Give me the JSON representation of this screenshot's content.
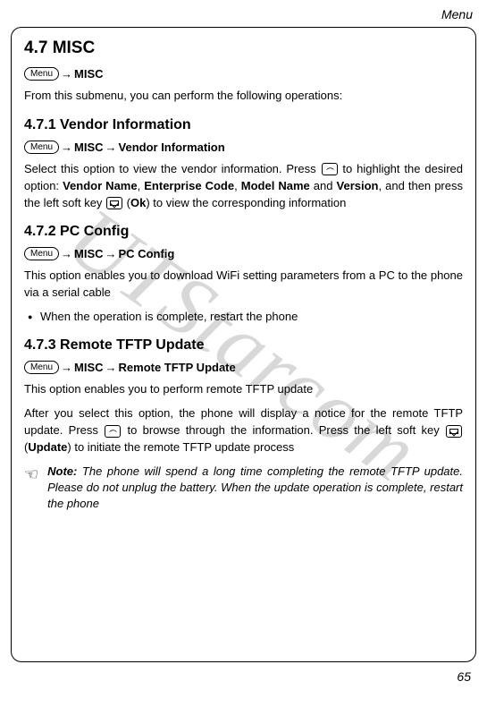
{
  "header": {
    "category": "Menu"
  },
  "page_number": "65",
  "menu_button_label": "Menu",
  "section": {
    "number_title": "4.7 MISC",
    "nav_path": "MISC",
    "intro": "From this submenu, you can perform the following operations:"
  },
  "sub1": {
    "title": "4.7.1 Vendor Information",
    "nav1": "MISC",
    "nav2": "Vendor Information",
    "para_parts": {
      "t1": "Select this option to view the vendor information. Press ",
      "t2": " to highlight the desired option: ",
      "b1": "Vendor Name",
      "t3": ", ",
      "b2": "Enterprise Code",
      "t4": ", ",
      "b3": "Model Name",
      "t5": " and ",
      "b4": "Version",
      "t6": ", and then press the left soft key ",
      "t7": " (",
      "b5": "Ok",
      "t8": ") to view the corresponding information"
    }
  },
  "sub2": {
    "title": "4.7.2 PC Config",
    "nav1": "MISC",
    "nav2": "PC Config",
    "para": "This option enables you to download WiFi setting parameters from a PC to the phone via a serial cable",
    "bullet1": "When the operation is complete, restart the phone"
  },
  "sub3": {
    "title": "4.7.3 Remote TFTP Update",
    "nav1": "MISC",
    "nav2": "Remote TFTP Update",
    "para1": "This option enables you to perform remote TFTP update",
    "para2_parts": {
      "t1": "After you select this option, the phone will display a notice for the remote TFTP update. Press ",
      "t2": " to browse through the information. Press the left soft key ",
      "t3": " (",
      "b1": "Update",
      "t4": ") to initiate the remote TFTP update process"
    },
    "note_label": "Note:",
    "note_text": " The phone will spend a long time completing the remote TFTP update. Please do not unplug the battery. When the update operation is complete, restart the phone"
  },
  "watermark": "UTStarcom"
}
